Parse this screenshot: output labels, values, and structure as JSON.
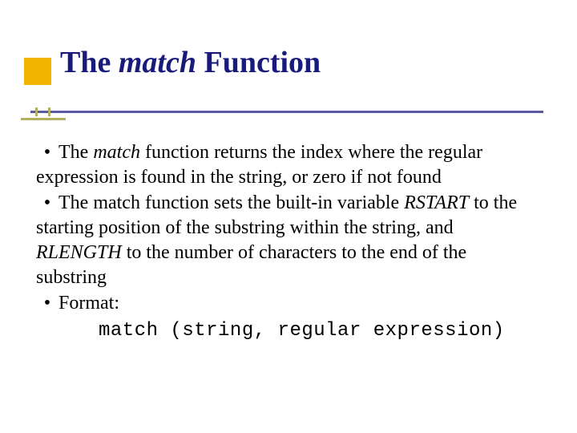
{
  "title": {
    "pre": "The ",
    "em": "match",
    "post": " Function"
  },
  "bullets": {
    "b1": {
      "pre": "The ",
      "em": "match",
      "post": " function returns the index where the regular expression is found in the string, or zero if not found"
    },
    "b2": {
      "pre": "The match function sets the built-in variable ",
      "em1": "RSTART",
      "mid": " to the starting position of the substring within the string, and ",
      "em2": "RLENGTH",
      "post": " to the number of characters to the end of the substring"
    },
    "b3": {
      "text": "Format:"
    }
  },
  "code": "match (string, regular expression)"
}
